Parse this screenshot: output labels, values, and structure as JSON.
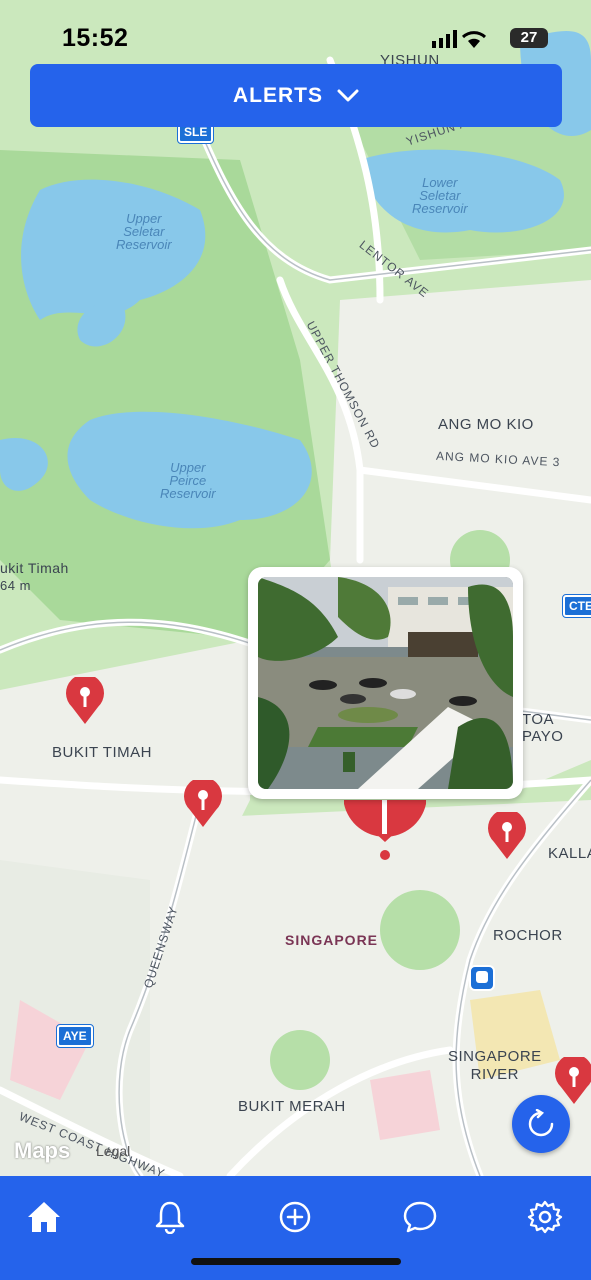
{
  "status": {
    "time": "15:52",
    "battery": "27"
  },
  "header": {
    "alerts_label": "ALERTS"
  },
  "map": {
    "water_labels": [
      {
        "text": "Upper\nSeletar\nReservoir"
      },
      {
        "text": "Lower\nSeletar\nReservoir"
      },
      {
        "text": "Upper\nPeirce\nReservoir"
      }
    ],
    "places": {
      "yishun": "YISHUN",
      "ang_mo_kio": "ANG MO KIO",
      "bukit_timah": "BUKIT TIMAH",
      "bukit_timah_hill": "ukit Timah",
      "bukit_timah_hill_elev": "64 m",
      "toa_payoh": "TOA PAYO",
      "kallang": "KALLA",
      "rochor": "ROCHOR",
      "singapore": "SINGAPORE",
      "singapore_river": "SINGAPORE\nRIVER",
      "bukit_merah": "BUKIT MERAH"
    },
    "roads": {
      "yishun_ave": "YISHUN A",
      "lentor_ave": "LENTOR AVE",
      "upper_thomson": "UPPER THOMSON RD",
      "ang_mo_kio_ave3": "ANG MO KIO AVE 3",
      "queensway": "QUEENSWAY",
      "west_coast": "WEST COAST HIGHWAY"
    },
    "shields": {
      "sle": "SLE",
      "cte": "CTE",
      "aye": "AYE"
    },
    "attribution": {
      "logo": "Maps",
      "legal": "Legal"
    },
    "alert_color": "#d93840"
  },
  "tabs": [
    {
      "name": "home"
    },
    {
      "name": "notifications"
    },
    {
      "name": "add"
    },
    {
      "name": "chat"
    },
    {
      "name": "settings"
    }
  ]
}
